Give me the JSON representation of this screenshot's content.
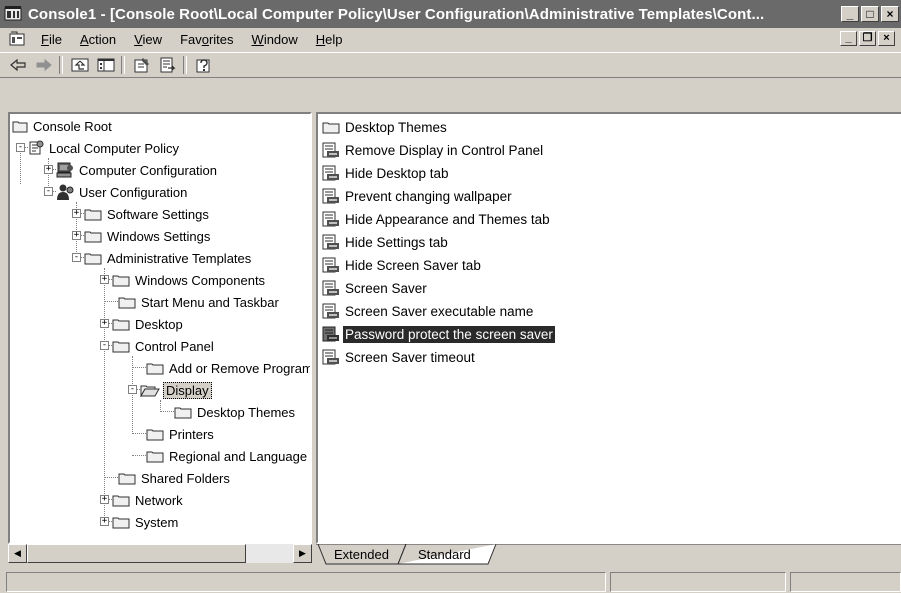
{
  "window": {
    "title": "Console1 - [Console Root\\Local Computer Policy\\User Configuration\\Administrative Templates\\Cont...",
    "minimize": "_",
    "maximize": "□",
    "close": "×"
  },
  "menu": {
    "items": [
      {
        "key": "F",
        "rest": "ile"
      },
      {
        "key": "A",
        "rest": "ction"
      },
      {
        "key": "V",
        "rest": "iew"
      },
      {
        "pre": "Fav",
        "key": "o",
        "rest": "rites"
      },
      {
        "key": "W",
        "rest": "indow"
      },
      {
        "key": "H",
        "rest": "elp"
      }
    ],
    "mdi_minimize": "_",
    "mdi_restore": "❐",
    "mdi_close": "×"
  },
  "toolbar": {
    "icons": [
      "back-arrow-icon",
      "forward-arrow-icon",
      "up-one-level-icon",
      "show-hide-tree-icon",
      "properties-icon",
      "export-list-icon",
      "help-icon"
    ]
  },
  "tree": {
    "items": [
      {
        "label": "Console Root",
        "icon": "folder-icon"
      },
      {
        "label": "Local Computer Policy",
        "icon": "policy-icon"
      },
      {
        "label": "Computer Configuration",
        "icon": "computer-icon"
      },
      {
        "label": "User Configuration",
        "icon": "user-icon"
      },
      {
        "label": "Software Settings",
        "icon": "folder-icon"
      },
      {
        "label": "Windows Settings",
        "icon": "folder-icon"
      },
      {
        "label": "Administrative Templates",
        "icon": "folder-icon"
      },
      {
        "label": "Windows Components",
        "icon": "folder-icon"
      },
      {
        "label": "Start Menu and Taskbar",
        "icon": "folder-icon"
      },
      {
        "label": "Desktop",
        "icon": "folder-icon"
      },
      {
        "label": "Control Panel",
        "icon": "folder-icon"
      },
      {
        "label": "Add or Remove Programs",
        "icon": "folder-icon"
      },
      {
        "label": "Display",
        "icon": "open-folder-icon"
      },
      {
        "label": "Desktop Themes",
        "icon": "folder-icon"
      },
      {
        "label": "Printers",
        "icon": "folder-icon"
      },
      {
        "label": "Regional and Language Options",
        "icon": "folder-icon"
      },
      {
        "label": "Shared Folders",
        "icon": "folder-icon"
      },
      {
        "label": "Network",
        "icon": "folder-icon"
      },
      {
        "label": "System",
        "icon": "folder-icon"
      }
    ]
  },
  "list": {
    "items": [
      {
        "label": "Desktop Themes",
        "icon": "folder-icon"
      },
      {
        "label": "Remove Display in Control Panel",
        "icon": "policy-setting-icon"
      },
      {
        "label": "Hide Desktop tab",
        "icon": "policy-setting-icon"
      },
      {
        "label": "Prevent changing wallpaper",
        "icon": "policy-setting-icon"
      },
      {
        "label": "Hide Appearance and Themes tab",
        "icon": "policy-setting-icon"
      },
      {
        "label": "Hide Settings tab",
        "icon": "policy-setting-icon"
      },
      {
        "label": "Hide Screen Saver tab",
        "icon": "policy-setting-icon"
      },
      {
        "label": "Screen Saver",
        "icon": "policy-setting-icon"
      },
      {
        "label": "Screen Saver executable name",
        "icon": "policy-setting-icon"
      },
      {
        "label": "Password protect the screen saver",
        "icon": "policy-setting-icon",
        "selected": true
      },
      {
        "label": "Screen Saver timeout",
        "icon": "policy-setting-icon"
      }
    ]
  },
  "tabs": {
    "extended": "Extended",
    "standard": "Standard",
    "active": "Standard"
  },
  "colors": {
    "chrome": "#d4d0c8",
    "title_bar": "#6a6a6a",
    "selection": "#2a2a2a"
  }
}
